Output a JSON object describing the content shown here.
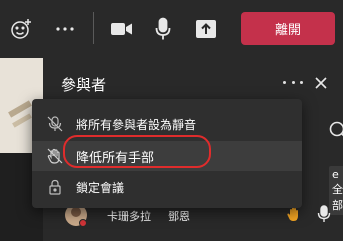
{
  "toolbar": {
    "leave_label": "離開",
    "icons": [
      "reaction-icon",
      "more-icon",
      "camera-icon",
      "microphone-icon",
      "share-icon"
    ]
  },
  "panel": {
    "title": "參與者",
    "mute_all_tag": "e 全部"
  },
  "menu": {
    "items": [
      {
        "label": "將所有參與者設為靜音",
        "icon": "mic-off-icon"
      },
      {
        "label": "降低所有手部",
        "icon": "lower-hand-icon"
      },
      {
        "label": "鎖定會議",
        "icon": "lock-icon"
      }
    ]
  },
  "participant": {
    "name": "卡珊多拉",
    "name2": "鄧恩"
  },
  "colors": {
    "leave": "#c4314b",
    "highlight": "#e02c2c",
    "hand": "#f5a623"
  }
}
